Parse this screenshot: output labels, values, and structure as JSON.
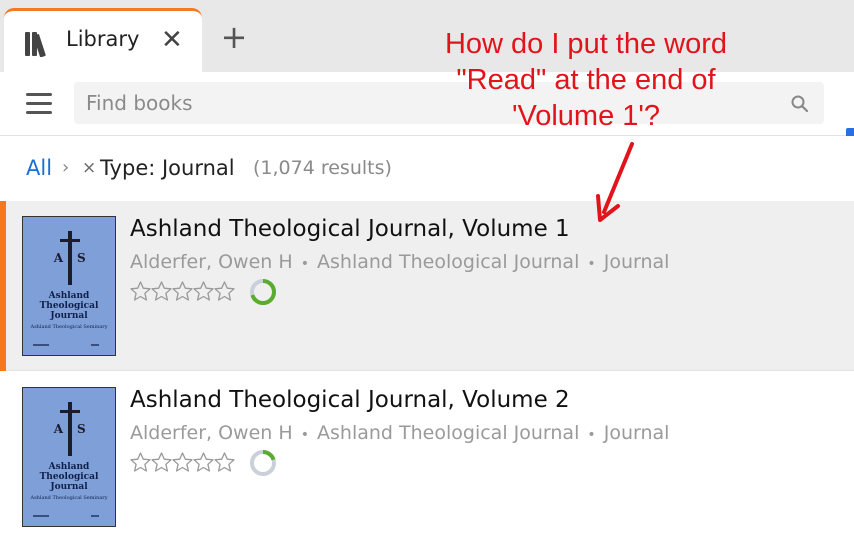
{
  "tabs": [
    {
      "label": "Library",
      "close_glyph": "✕",
      "icon": "library-books-icon"
    }
  ],
  "new_tab_glyph": "+",
  "search": {
    "placeholder": "Find books",
    "value": ""
  },
  "breadcrumb": {
    "root": "All",
    "separator": "›",
    "remove_glyph": "×",
    "filter": "Type: Journal",
    "count": "(1,074 results)"
  },
  "results": [
    {
      "title": "Ashland Theological Journal, Volume 1",
      "author": "Alderfer, Owen H",
      "series": "Ashland Theological Journal",
      "type": "Journal",
      "rating": 0,
      "rating_max": 5,
      "progress": 0.7,
      "selected": true,
      "cover": {
        "letters": [
          "A",
          "S"
        ],
        "title_lines": [
          "Ashland",
          "Theological",
          "Journal"
        ],
        "subtitle": "Ashland Theological Seminary"
      }
    },
    {
      "title": "Ashland Theological Journal, Volume 2",
      "author": "Alderfer, Owen H",
      "series": "Ashland Theological Journal",
      "type": "Journal",
      "rating": 0,
      "rating_max": 5,
      "progress": 0.2,
      "selected": false,
      "cover": {
        "letters": [
          "A",
          "S"
        ],
        "title_lines": [
          "Ashland",
          "Theological",
          "Journal"
        ],
        "subtitle": "Ashland Theological Seminary"
      }
    }
  ],
  "meta_separator": "•",
  "annotation": {
    "lines": [
      "How do I put the word",
      "\"Read\" at the end of",
      "'Volume 1'?"
    ],
    "color": "#e0141a"
  },
  "colors": {
    "accent_orange": "#f47920",
    "link_blue": "#1a6fd6",
    "progress_green": "#5aab2e",
    "progress_track": "#c9d0da",
    "cover_blue": "#7f9fd8"
  }
}
